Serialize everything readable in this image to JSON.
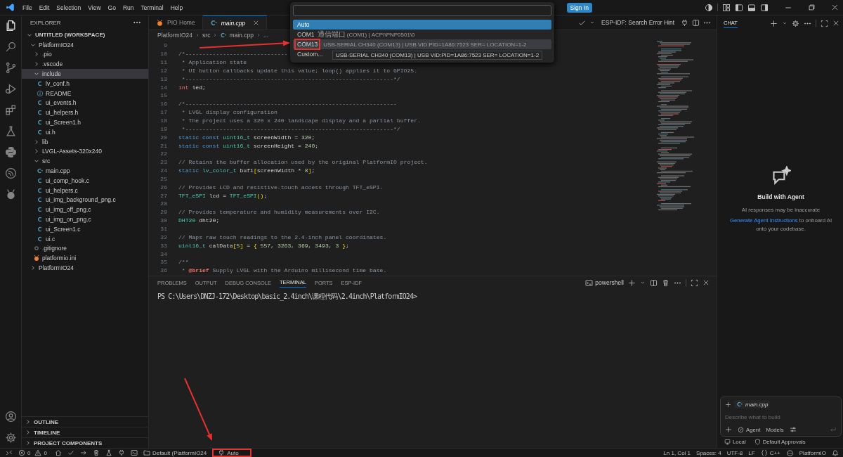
{
  "menu": [
    "File",
    "Edit",
    "Selection",
    "View",
    "Go",
    "Run",
    "Terminal",
    "Help"
  ],
  "sign_in": "Sign In",
  "sidebar": {
    "title": "EXPLORER",
    "tree": [
      {
        "label": "UNTITLED (WORKSPACE)",
        "kind": "root",
        "expanded": true,
        "selected": false,
        "children": [
          {
            "label": "PlatformIO24",
            "kind": "folder",
            "expanded": true,
            "selected": false,
            "children": [
              {
                "label": ".pio",
                "kind": "folder",
                "expanded": false,
                "selected": false
              },
              {
                "label": ".vscode",
                "kind": "folder",
                "expanded": false,
                "selected": false
              },
              {
                "label": "include",
                "kind": "folder",
                "expanded": true,
                "selected": true,
                "children": [
                  {
                    "label": "lv_conf.h",
                    "kind": "c",
                    "selected": false
                  },
                  {
                    "label": "README",
                    "kind": "info",
                    "selected": false
                  },
                  {
                    "label": "ui_events.h",
                    "kind": "c",
                    "selected": false
                  },
                  {
                    "label": "ui_helpers.h",
                    "kind": "c",
                    "selected": false
                  },
                  {
                    "label": "ui_Screen1.h",
                    "kind": "c",
                    "selected": false
                  },
                  {
                    "label": "ui.h",
                    "kind": "c",
                    "selected": false
                  }
                ]
              },
              {
                "label": "lib",
                "kind": "folder",
                "expanded": false,
                "selected": false
              },
              {
                "label": "LVGL-Assets-320x240",
                "kind": "folder",
                "expanded": false,
                "selected": false
              },
              {
                "label": "src",
                "kind": "folder",
                "expanded": true,
                "selected": false,
                "children": [
                  {
                    "label": "main.cpp",
                    "kind": "cpp",
                    "selected": false
                  },
                  {
                    "label": "ui_comp_hook.c",
                    "kind": "c",
                    "selected": false
                  },
                  {
                    "label": "ui_helpers.c",
                    "kind": "c",
                    "selected": false
                  },
                  {
                    "label": "ui_img_background_png.c",
                    "kind": "c",
                    "selected": false
                  },
                  {
                    "label": "ui_img_off_png.c",
                    "kind": "c",
                    "selected": false
                  },
                  {
                    "label": "ui_img_on_png.c",
                    "kind": "c",
                    "selected": false
                  },
                  {
                    "label": "ui_Screen1.c",
                    "kind": "c",
                    "selected": false
                  },
                  {
                    "label": "ui.c",
                    "kind": "c",
                    "selected": false
                  }
                ]
              },
              {
                "label": ".gitignore",
                "kind": "git",
                "selected": false
              },
              {
                "label": "platformio.ini",
                "kind": "pio",
                "selected": false
              }
            ]
          },
          {
            "label": "PlatformIO24",
            "kind": "folder",
            "expanded": false,
            "selected": false
          }
        ]
      }
    ],
    "sections": [
      {
        "label": "OUTLINE",
        "expanded": false
      },
      {
        "label": "TIMELINE",
        "expanded": false
      },
      {
        "label": "PROJECT COMPONENTS",
        "expanded": false
      }
    ]
  },
  "editor": {
    "tabs": [
      {
        "label": "PIO Home",
        "kind": "pio",
        "selected": false,
        "preview": false
      },
      {
        "label": "main.cpp",
        "kind": "cpp",
        "selected": true,
        "preview": true
      }
    ],
    "toolbar_label": "ESP-IDF: Search Error Hint",
    "breadcrumb": [
      {
        "label": "PlatformIO24",
        "kind": "folder"
      },
      {
        "label": "src",
        "kind": "folder"
      },
      {
        "label": "main.cpp",
        "kind": "cpp"
      },
      {
        "label": "...",
        "kind": "more"
      }
    ],
    "lines": [
      {
        "number": "9"
      },
      {
        "number": "10",
        "tokens": [
          {
            "kind": "comment",
            "text": "/*------------------------------"
          }
        ]
      },
      {
        "number": "11",
        "tokens": [
          {
            "kind": "comment",
            "text": " * Application state"
          }
        ]
      },
      {
        "number": "12",
        "tokens": [
          {
            "kind": "comment",
            "text": " * UI button callbacks update this value; loop() applies it to GPIO25."
          }
        ]
      },
      {
        "number": "13",
        "tokens": [
          {
            "kind": "comment",
            "text": " *-------------------------------------------------------------*/"
          }
        ]
      },
      {
        "number": "14",
        "tokens": [
          {
            "kind": "keyword",
            "text": "int"
          },
          {
            "kind": "plain",
            "text": " led;"
          }
        ]
      },
      {
        "number": "15"
      },
      {
        "number": "16",
        "tokens": [
          {
            "kind": "comment",
            "text": "/*--------------------------------------------------------------"
          }
        ]
      },
      {
        "number": "17",
        "tokens": [
          {
            "kind": "comment",
            "text": " * LVGL display configuration"
          }
        ]
      },
      {
        "number": "18",
        "tokens": [
          {
            "kind": "comment",
            "text": " * The project uses a 320 x 240 landscape display and a partial buffer."
          }
        ]
      },
      {
        "number": "19",
        "tokens": [
          {
            "kind": "comment",
            "text": " *-------------------------------------------------------------*/"
          }
        ]
      },
      {
        "number": "20",
        "tokens": [
          {
            "kind": "storage",
            "text": "static const"
          },
          {
            "kind": "type",
            "text": " uint16_t"
          },
          {
            "kind": "plain",
            "text": " screenWidth = "
          },
          {
            "kind": "number",
            "text": "320"
          },
          {
            "kind": "plain",
            "text": ";"
          }
        ]
      },
      {
        "number": "21",
        "tokens": [
          {
            "kind": "storage",
            "text": "static const"
          },
          {
            "kind": "type",
            "text": " uint16_t"
          },
          {
            "kind": "plain",
            "text": " screenHeight = "
          },
          {
            "kind": "number",
            "text": "240"
          },
          {
            "kind": "plain",
            "text": ";"
          }
        ]
      },
      {
        "number": "22"
      },
      {
        "number": "23",
        "tokens": [
          {
            "kind": "comment",
            "text": "// Retains the buffer allocation used by the original PlatformIO project."
          }
        ]
      },
      {
        "number": "24",
        "tokens": [
          {
            "kind": "storage",
            "text": "static"
          },
          {
            "kind": "type",
            "text": " lv_color_t"
          },
          {
            "kind": "plain",
            "text": " buf1"
          },
          {
            "kind": "bracket",
            "text": "["
          },
          {
            "kind": "plain",
            "text": "screenWidth * "
          },
          {
            "kind": "number",
            "text": "8"
          },
          {
            "kind": "bracket",
            "text": "]"
          },
          {
            "kind": "plain",
            "text": ";"
          }
        ]
      },
      {
        "number": "25"
      },
      {
        "number": "26",
        "tokens": [
          {
            "kind": "comment",
            "text": "// Provides LCD and resistive-touch access through TFT_eSPI."
          }
        ]
      },
      {
        "number": "27",
        "tokens": [
          {
            "kind": "type",
            "text": "TFT_eSPI"
          },
          {
            "kind": "plain",
            "text": " lcd = "
          },
          {
            "kind": "type",
            "text": "TFT_eSPI"
          },
          {
            "kind": "bracket",
            "text": "()"
          },
          {
            "kind": "plain",
            "text": ";"
          }
        ]
      },
      {
        "number": "28"
      },
      {
        "number": "29",
        "tokens": [
          {
            "kind": "comment",
            "text": "// Provides temperature and humidity measurements over I2C."
          }
        ]
      },
      {
        "number": "30",
        "tokens": [
          {
            "kind": "type",
            "text": "DHT20"
          },
          {
            "kind": "plain",
            "text": " dht20;"
          }
        ]
      },
      {
        "number": "31"
      },
      {
        "number": "32",
        "tokens": [
          {
            "kind": "comment",
            "text": "// Maps raw touch readings to the 2.4-inch panel coordinates."
          }
        ]
      },
      {
        "number": "33",
        "tokens": [
          {
            "kind": "type",
            "text": "uint16_t"
          },
          {
            "kind": "plain",
            "text": " calData"
          },
          {
            "kind": "bracket",
            "text": "["
          },
          {
            "kind": "number",
            "text": "5"
          },
          {
            "kind": "bracket",
            "text": "]"
          },
          {
            "kind": "plain",
            "text": " = "
          },
          {
            "kind": "bracket",
            "text": "{"
          },
          {
            "kind": "number",
            "text": " 557, 3263, 369, 3493, 3 "
          },
          {
            "kind": "bracket",
            "text": "}"
          },
          {
            "kind": "plain",
            "text": ";"
          }
        ]
      },
      {
        "number": "34"
      },
      {
        "number": "35",
        "tokens": [
          {
            "kind": "comment",
            "text": "/**"
          }
        ]
      },
      {
        "number": "36",
        "tokens": [
          {
            "kind": "comment",
            "text": " * "
          },
          {
            "kind": "doctag",
            "text": "@brief"
          },
          {
            "kind": "comment",
            "text": " Supply LVGL with the Arduino millisecond time base."
          }
        ]
      }
    ]
  },
  "quick_pick": {
    "items": [
      {
        "label": "Auto",
        "selected": true,
        "hovered": false,
        "highlighted": false
      },
      {
        "label": "COM1",
        "description": "通信端口 (COM1) | ACPI\\PNP0501\\0",
        "selected": false,
        "hovered": false,
        "highlighted": false
      },
      {
        "label": "COM13",
        "description": "USB-SERIAL CH340 (COM13) | USB VID:PID=1A86:7523 SER= LOCATION=1-2",
        "selected": false,
        "hovered": true,
        "highlighted": true
      },
      {
        "label": "Custom...",
        "selected": false,
        "hovered": false,
        "highlighted": false
      }
    ],
    "tooltip": "USB-SERIAL CH340 (COM13) | USB VID:PID=1A86:7523 SER= LOCATION=1-2"
  },
  "panel": {
    "tabs": [
      {
        "label": "PROBLEMS",
        "selected": false
      },
      {
        "label": "OUTPUT",
        "selected": false
      },
      {
        "label": "DEBUG CONSOLE",
        "selected": false
      },
      {
        "label": "TERMINAL",
        "selected": true
      },
      {
        "label": "PORTS",
        "selected": false
      },
      {
        "label": "ESP-IDF",
        "selected": false
      }
    ],
    "terminal_name": "powershell",
    "terminal_lines": [
      "PS C:\\Users\\DNZJ-172\\Desktop\\basic_2.4inch\\课程代码\\2.4inch\\PlatformIO24>"
    ]
  },
  "chat": {
    "tab": "CHAT",
    "heading": "Build with Agent",
    "note": "AI responses may be inaccurate",
    "link": "Generate Agent Instructions",
    "link_rest": "to onboard AI onto your codebase.",
    "context_file": "main.cpp",
    "placeholder": "Describe what to build",
    "mode": "Agent",
    "models": "Models",
    "footer": [
      "Local",
      "Default Approvals"
    ]
  },
  "status_bar": {
    "errors": "0",
    "warnings": "0",
    "environment": "Default (PlatformIO24",
    "port": {
      "label": "Auto",
      "highlighted": true
    },
    "right": [
      "Ln 1, Col 1",
      "Spaces: 4",
      "UTF-8",
      "LF"
    ],
    "language": "C++",
    "platformio": "PlatformIO"
  }
}
